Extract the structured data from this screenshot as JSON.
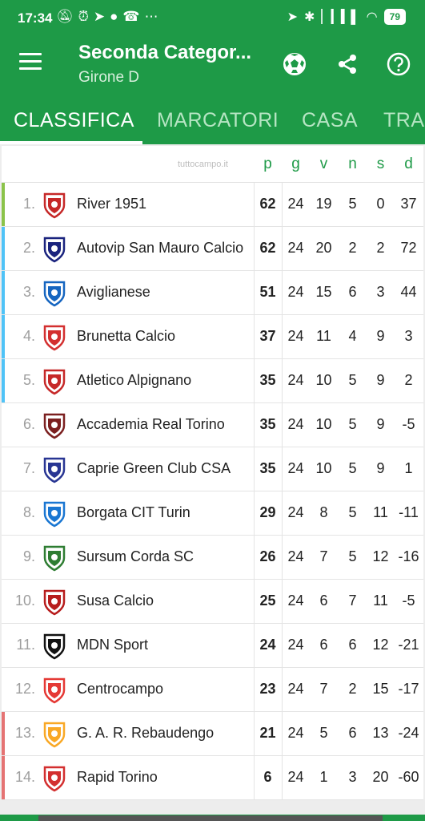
{
  "status": {
    "time": "17:34",
    "battery": "79"
  },
  "header": {
    "title": "Seconda Categor...",
    "subtitle": "Girone D"
  },
  "tabs": [
    {
      "label": "CLASSIFICA"
    },
    {
      "label": "MARCATORI"
    },
    {
      "label": "CASA"
    },
    {
      "label": "TRA"
    }
  ],
  "table": {
    "watermark": "tuttocampo.it",
    "columns": [
      "p",
      "g",
      "v",
      "n",
      "s",
      "d"
    ],
    "rows": [
      {
        "pos": "1.",
        "team": "River 1951",
        "p": "62",
        "g": "24",
        "v": "19",
        "n": "5",
        "s": "0",
        "d": "37",
        "strip": "#8bc34a",
        "crest": "#c62828"
      },
      {
        "pos": "2.",
        "team": "Autovip San Mauro Calcio",
        "p": "62",
        "g": "24",
        "v": "20",
        "n": "2",
        "s": "2",
        "d": "72",
        "strip": "#4fc3f7",
        "crest": "#1a237e"
      },
      {
        "pos": "3.",
        "team": "Aviglianese",
        "p": "51",
        "g": "24",
        "v": "15",
        "n": "6",
        "s": "3",
        "d": "44",
        "strip": "#4fc3f7",
        "crest": "#1565c0"
      },
      {
        "pos": "4.",
        "team": "Brunetta Calcio",
        "p": "37",
        "g": "24",
        "v": "11",
        "n": "4",
        "s": "9",
        "d": "3",
        "strip": "#4fc3f7",
        "crest": "#d32f2f"
      },
      {
        "pos": "5.",
        "team": "Atletico Alpignano",
        "p": "35",
        "g": "24",
        "v": "10",
        "n": "5",
        "s": "9",
        "d": "2",
        "strip": "#4fc3f7",
        "crest": "#c62828"
      },
      {
        "pos": "6.",
        "team": "Accademia Real Torino",
        "p": "35",
        "g": "24",
        "v": "10",
        "n": "5",
        "s": "9",
        "d": "-5",
        "strip": "",
        "crest": "#7b1f1f"
      },
      {
        "pos": "7.",
        "team": "Caprie Green Club CSA",
        "p": "35",
        "g": "24",
        "v": "10",
        "n": "5",
        "s": "9",
        "d": "1",
        "strip": "",
        "crest": "#283593"
      },
      {
        "pos": "8.",
        "team": "Borgata CIT Turin",
        "p": "29",
        "g": "24",
        "v": "8",
        "n": "5",
        "s": "11",
        "d": "-11",
        "strip": "",
        "crest": "#1976d2"
      },
      {
        "pos": "9.",
        "team": "Sursum Corda SC",
        "p": "26",
        "g": "24",
        "v": "7",
        "n": "5",
        "s": "12",
        "d": "-16",
        "strip": "",
        "crest": "#2e7d32"
      },
      {
        "pos": "10.",
        "team": "Susa Calcio",
        "p": "25",
        "g": "24",
        "v": "6",
        "n": "7",
        "s": "11",
        "d": "-5",
        "strip": "",
        "crest": "#b71c1c"
      },
      {
        "pos": "11.",
        "team": "MDN Sport",
        "p": "24",
        "g": "24",
        "v": "6",
        "n": "6",
        "s": "12",
        "d": "-21",
        "strip": "",
        "crest": "#111111"
      },
      {
        "pos": "12.",
        "team": "Centrocampo",
        "p": "23",
        "g": "24",
        "v": "7",
        "n": "2",
        "s": "15",
        "d": "-17",
        "strip": "",
        "crest": "#e53935"
      },
      {
        "pos": "13.",
        "team": "G. A. R. Rebaudengo",
        "p": "21",
        "g": "24",
        "v": "5",
        "n": "6",
        "s": "13",
        "d": "-24",
        "strip": "#e57373",
        "crest": "#f9a825"
      },
      {
        "pos": "14.",
        "team": "Rapid Torino",
        "p": "6",
        "g": "24",
        "v": "1",
        "n": "3",
        "s": "20",
        "d": "-60",
        "strip": "#e57373",
        "crest": "#d32f2f"
      }
    ]
  }
}
